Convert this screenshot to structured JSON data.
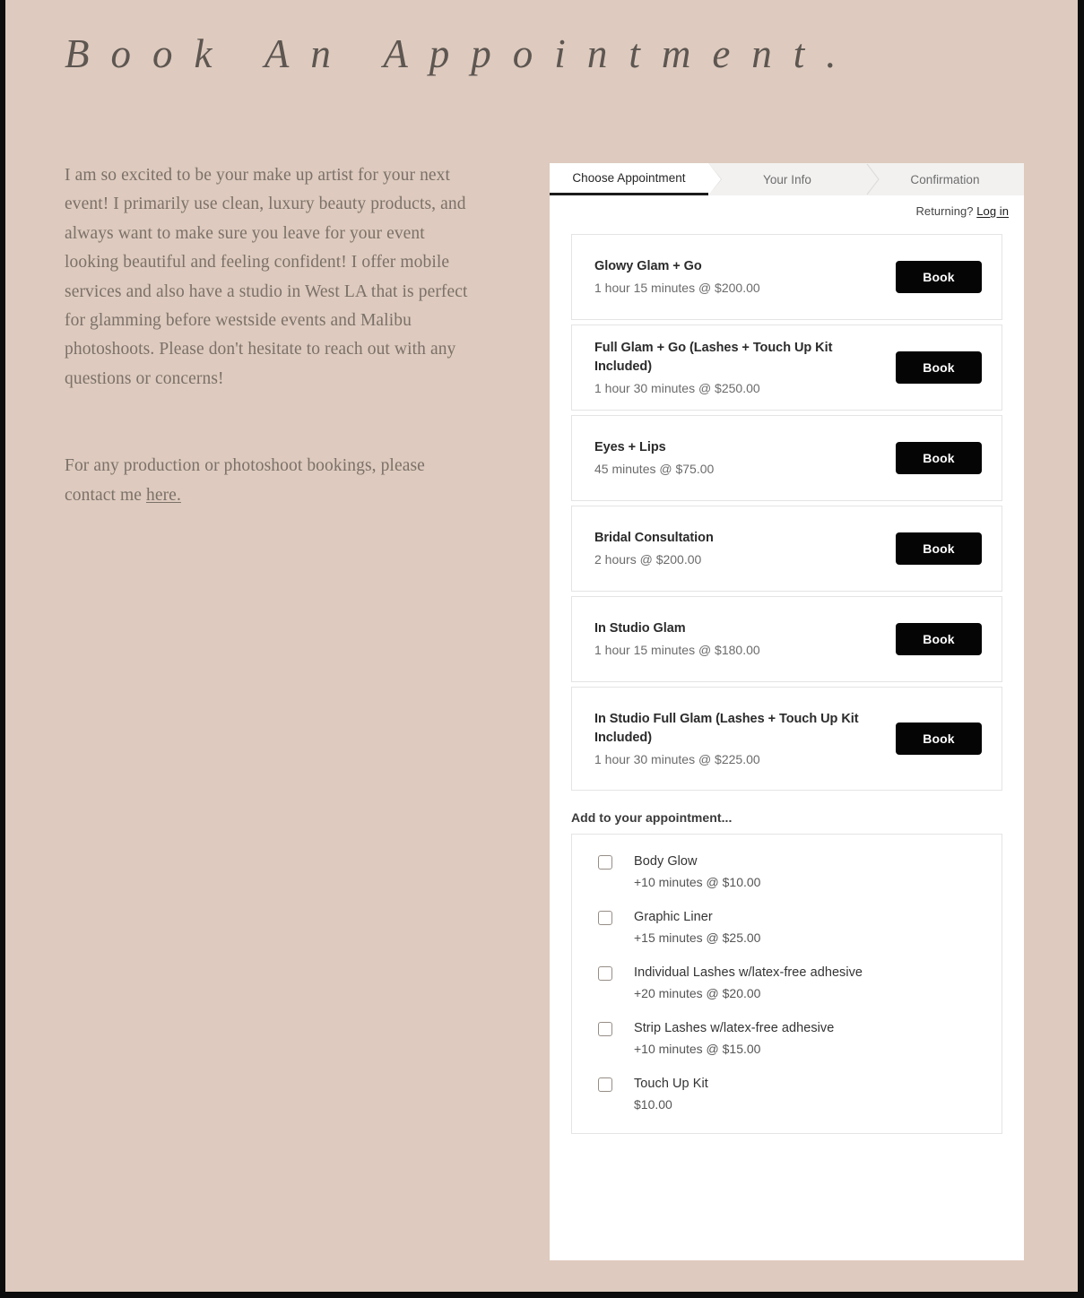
{
  "page": {
    "title": "Book An Appointment.",
    "background_color": "#decabe",
    "frame_color": "#0d0d0d"
  },
  "intro": {
    "paragraph_1": "I am so excited to be your make up artist for your next event! I primarily use clean, luxury beauty products, and always want to make sure you leave for your event looking beautiful and feeling confident! I offer mobile services and also have a studio in West LA that is perfect for glamming before westside events and Malibu photoshoots. Please don't hesitate to reach out with any questions or concerns!",
    "paragraph_2_before_link": "For any production or photoshoot bookings, please contact me ",
    "paragraph_2_link": "here."
  },
  "widget": {
    "tabs": [
      {
        "label": "Choose Appointment",
        "active": true
      },
      {
        "label": "Your Info",
        "active": false
      },
      {
        "label": "Confirmation",
        "active": false
      }
    ],
    "returning": {
      "prompt": "Returning?",
      "login_label": "Log in"
    },
    "book_button_label": "Book",
    "services": [
      {
        "name": "Glowy Glam + Go",
        "meta": "1 hour 15 minutes @ $200.00",
        "duration": "1 hour 15 minutes",
        "price": "$200.00"
      },
      {
        "name": "Full Glam + Go (Lashes + Touch Up Kit Included)",
        "meta": "1 hour 30 minutes @ $250.00",
        "duration": "1 hour 30 minutes",
        "price": "$250.00"
      },
      {
        "name": "Eyes + Lips",
        "meta": "45 minutes @ $75.00",
        "duration": "45 minutes",
        "price": "$75.00"
      },
      {
        "name": "Bridal Consultation",
        "meta": "2 hours @ $200.00",
        "duration": "2 hours",
        "price": "$200.00"
      },
      {
        "name": "In Studio Glam",
        "meta": "1 hour 15 minutes @ $180.00",
        "duration": "1 hour 15 minutes",
        "price": "$180.00"
      },
      {
        "name": "In Studio Full Glam (Lashes + Touch Up Kit Included)",
        "meta": "1 hour 30 minutes @ $225.00",
        "duration": "1 hour 30 minutes",
        "price": "$225.00"
      }
    ],
    "addons_heading": "Add to your appointment...",
    "addons": [
      {
        "name": "Body Glow",
        "meta": "+10 minutes @ $10.00",
        "checked": false
      },
      {
        "name": "Graphic Liner",
        "meta": "+15 minutes @ $25.00",
        "checked": false
      },
      {
        "name": "Individual Lashes w/latex-free adhesive",
        "meta": "+20 minutes @ $20.00",
        "checked": false
      },
      {
        "name": "Strip Lashes w/latex-free adhesive",
        "meta": "+10 minutes @ $15.00",
        "checked": false
      },
      {
        "name": "Touch Up Kit",
        "meta": "$10.00",
        "checked": false
      }
    ]
  }
}
